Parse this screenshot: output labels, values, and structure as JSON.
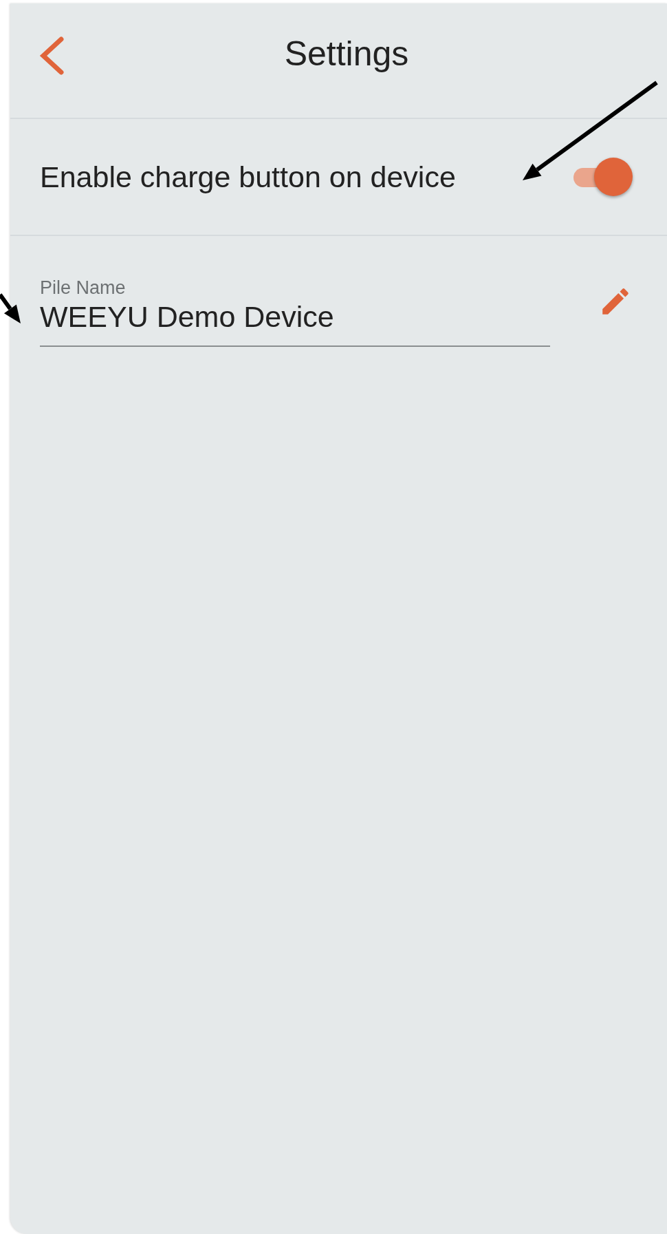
{
  "header": {
    "title": "Settings"
  },
  "toggle": {
    "label": "Enable charge button on device",
    "on": true
  },
  "field": {
    "label": "Pile Name",
    "value": "WEEYU Demo Device"
  },
  "annotations": [
    {
      "kind": "arrow"
    },
    {
      "kind": "arrow"
    }
  ]
}
